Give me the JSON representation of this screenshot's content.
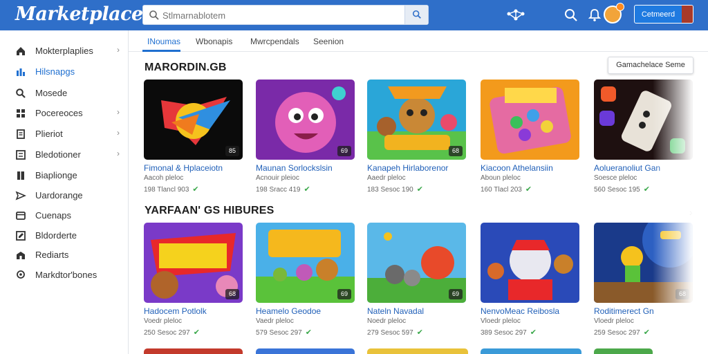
{
  "app": {
    "logo": "Marketplace",
    "search_placeholder": "Stlmarnablotem",
    "cta_label": "Cetmeerd"
  },
  "sidebar": {
    "items": [
      {
        "label": "Mokterplaplies",
        "icon": "home-icon",
        "chevron": true
      },
      {
        "label": "Hilsnapgs",
        "icon": "chart-icon",
        "active": true
      },
      {
        "label": "Mosede",
        "icon": "search-icon"
      },
      {
        "label": "Pocereoces",
        "icon": "grid-icon",
        "chevron": true
      },
      {
        "label": "Plieriot",
        "icon": "document-icon",
        "chevron": true
      },
      {
        "label": "Bledotioner",
        "icon": "list-icon",
        "chevron": true
      },
      {
        "label": "Biaplionge",
        "icon": "book-icon"
      },
      {
        "label": "Uardorange",
        "icon": "send-icon"
      },
      {
        "label": "Cuenaps",
        "icon": "card-icon"
      },
      {
        "label": "Bldorderte",
        "icon": "edit-icon"
      },
      {
        "label": "Rediarts",
        "icon": "building-icon"
      },
      {
        "label": "Markdtor'bones",
        "icon": "pin-icon"
      }
    ]
  },
  "tabs": [
    "INoumas",
    "Wbonapis",
    "Mwrcpendals",
    "Seenion"
  ],
  "game_button": "Gamachelace Seme",
  "sections": [
    {
      "title": "MARORDIN.GB",
      "cards": [
        {
          "title": "Fimonal & Hplaceiotn",
          "sub": "Aacoh pleloc",
          "meta": "198 Tlancl 903",
          "badge": "85"
        },
        {
          "title": "Maunan Sorlockslsin",
          "sub": "Acnouir pleioc",
          "meta": "198 Sracc 419",
          "badge": "69"
        },
        {
          "title": "Kanapeh Hirlaborenor",
          "sub": "Aaedr pleloc",
          "meta": "183 Sesoc 190",
          "badge": "68"
        },
        {
          "title": "Kiacoon Athelansiin",
          "sub": "Aboun pleloc",
          "meta": "160 Tlacl 203",
          "badge": ""
        },
        {
          "title": "Aolueranoliut Gan",
          "sub": "Soesce pleloc",
          "meta": "560 Sesoc 195",
          "badge": ""
        }
      ]
    },
    {
      "title": "YARFAAN' GS HIBURES",
      "cards": [
        {
          "title": "Hadocem Potlolk",
          "sub": "Voedr pleloc",
          "meta": "250 Sesoc 297",
          "badge": "68"
        },
        {
          "title": "Heamelo Geodoe",
          "sub": "Vaedr pleloc",
          "meta": "579 Sesoc 297",
          "badge": "69"
        },
        {
          "title": "Nateln Navadal",
          "sub": "Noedr pleloc",
          "meta": "279 Sesoc 597",
          "badge": "69"
        },
        {
          "title": "NenvoMeac Reibosla",
          "sub": "Vloedr pleloc",
          "meta": "389 Sesoc 297",
          "badge": ""
        },
        {
          "title": "Roditimerect Gn",
          "sub": "Vloedr pleloc",
          "meta": "259 Sesoc 297",
          "badge": "68"
        }
      ]
    }
  ],
  "colors": {
    "topbar": "#2f6fc9",
    "accent": "#1f6fd0",
    "cta": "#1f7ae0",
    "check": "#3aa84a"
  }
}
